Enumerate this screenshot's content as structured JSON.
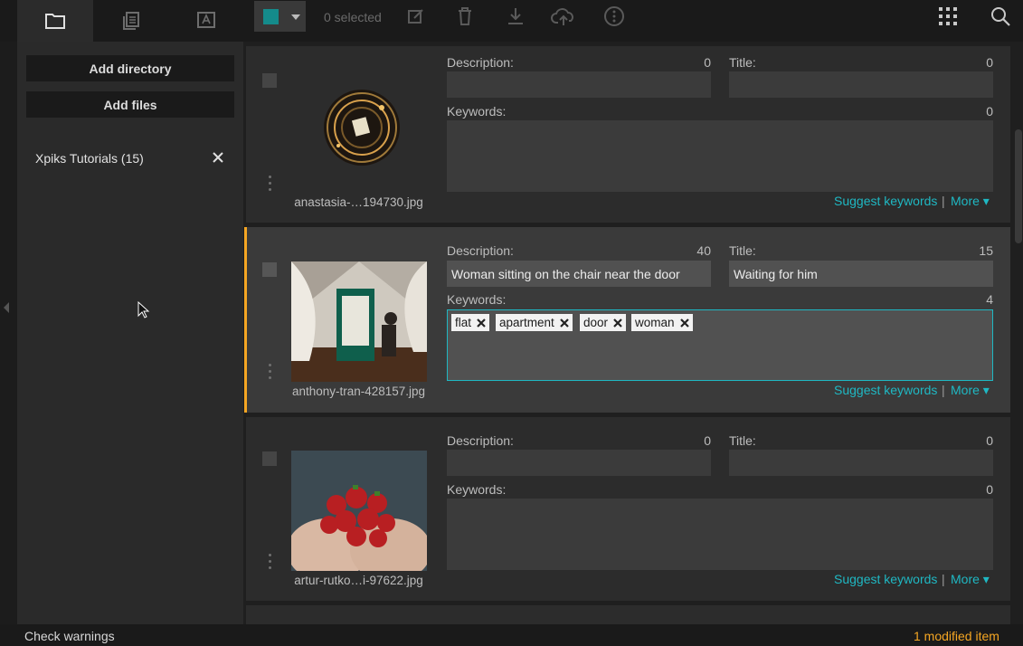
{
  "toolbar": {
    "tabs": [
      {
        "name": "folder-icon"
      },
      {
        "name": "copy-icon"
      },
      {
        "name": "text-icon"
      }
    ],
    "accent_color": "#148b8b",
    "selected_label": "0 selected",
    "tools": [
      "edit-icon",
      "trash-icon",
      "download-icon",
      "upload-icon",
      "info-icon"
    ],
    "right_tools": [
      "grid-icon",
      "search-icon"
    ]
  },
  "sidebar": {
    "add_directory": "Add directory",
    "add_files": "Add files",
    "directories": [
      {
        "label": "Xpiks Tutorials (15)"
      }
    ]
  },
  "items": [
    {
      "filename": "anastasia-…194730.jpg",
      "description_label": "Description:",
      "description_count": "0",
      "description": "",
      "title_label": "Title:",
      "title_count": "0",
      "title": "",
      "keywords_label": "Keywords:",
      "keywords_count": "0",
      "keywords": [],
      "suggest": "Suggest keywords",
      "separator": "|",
      "more": "More ▾",
      "selected": false
    },
    {
      "filename": "anthony-tran-428157.jpg",
      "description_label": "Description:",
      "description_count": "40",
      "description": "Woman sitting on the chair near the door",
      "title_label": "Title:",
      "title_count": "15",
      "title": "Waiting for him",
      "keywords_label": "Keywords:",
      "keywords_count": "4",
      "keywords": [
        "flat",
        "apartment",
        "door",
        "woman"
      ],
      "suggest": "Suggest keywords",
      "separator": "|",
      "more": "More ▾",
      "selected": true
    },
    {
      "filename": "artur-rutko…i-97622.jpg",
      "description_label": "Description:",
      "description_count": "0",
      "description": "",
      "title_label": "Title:",
      "title_count": "0",
      "title": "",
      "keywords_label": "Keywords:",
      "keywords_count": "0",
      "keywords": [],
      "suggest": "Suggest keywords",
      "separator": "|",
      "more": "More ▾",
      "selected": false
    }
  ],
  "status": {
    "check_warnings": "Check warnings",
    "modified": "1 modified item"
  }
}
